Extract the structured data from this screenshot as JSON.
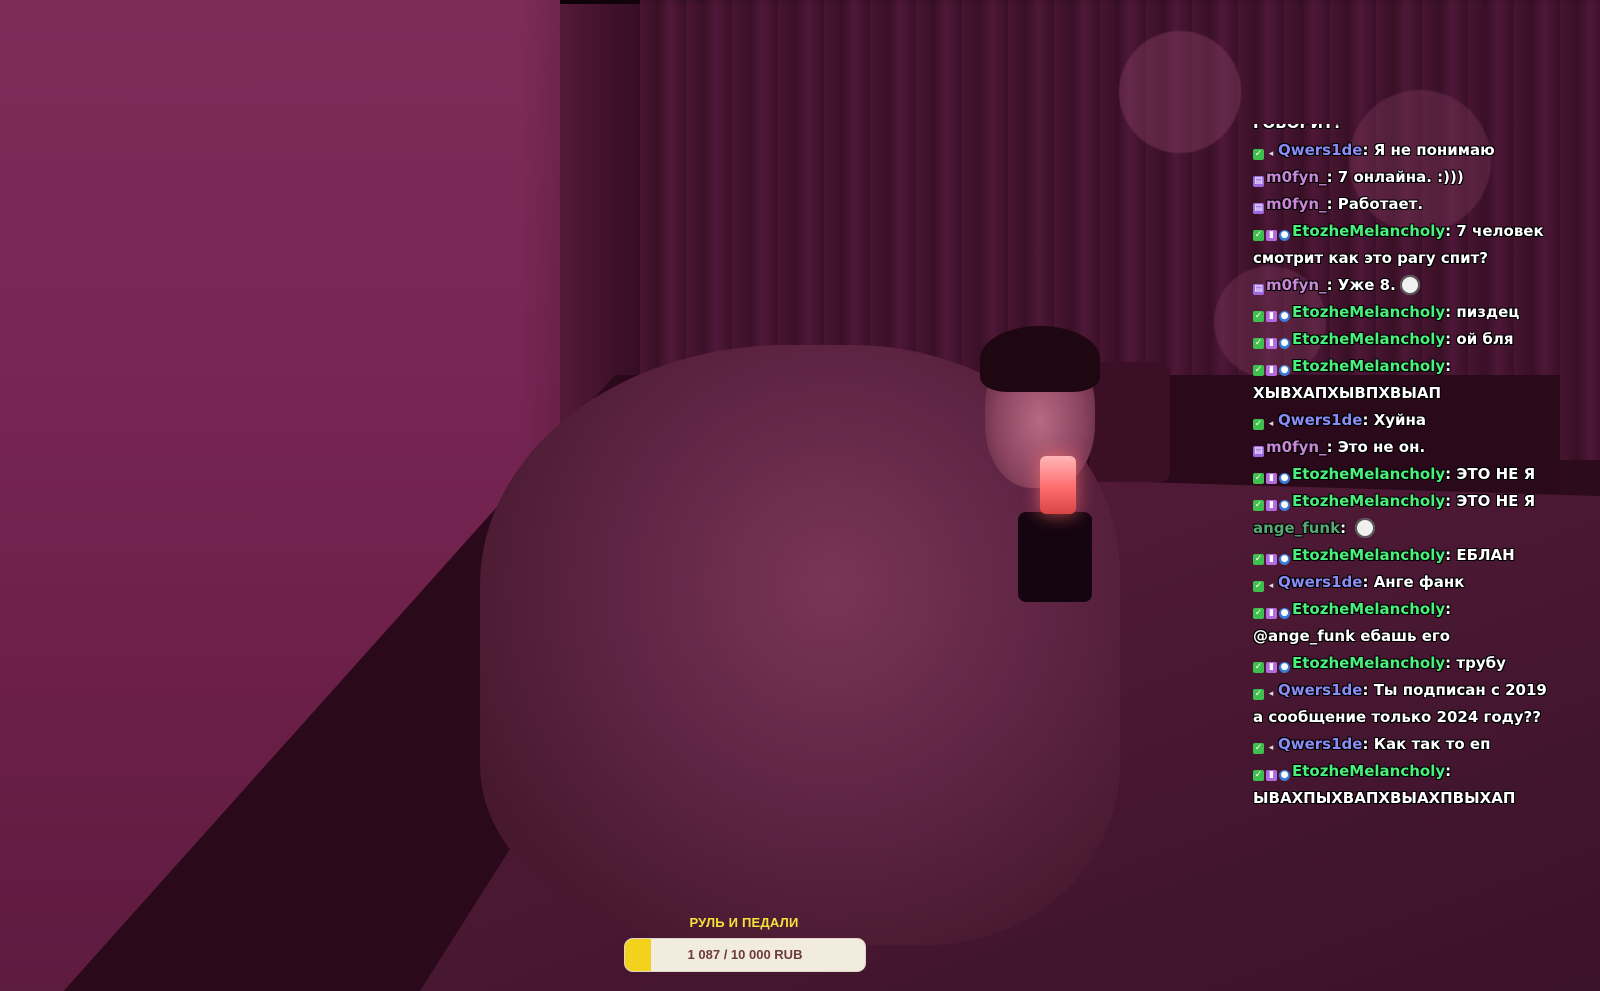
{
  "chat": {
    "messages": [
      {
        "user": "",
        "name_color": "green",
        "badges": [],
        "text": "ГОВОРИТ?",
        "partial": true
      },
      {
        "user": "Qwers1de",
        "name_color": "blue",
        "badges": [
          "check-icon",
          "sound-icon"
        ],
        "text": "Я не понимаю"
      },
      {
        "user": "m0fyn_",
        "name_color": "purple",
        "badges": [
          "mod-icon"
        ],
        "text": "7 онлайна. :)))"
      },
      {
        "user": "m0fyn_",
        "name_color": "purple",
        "badges": [
          "mod-icon"
        ],
        "text": "Работает."
      },
      {
        "user": "EtozheMelancholy",
        "name_color": "green",
        "badges": [
          "check-icon",
          "sub-icon",
          "vip-icon"
        ],
        "text": "7 человек смотрит как это рагу спит?"
      },
      {
        "user": "m0fyn_",
        "name_color": "purple",
        "badges": [
          "mod-icon"
        ],
        "text": "Уже 8.",
        "emote": "skull-emote"
      },
      {
        "user": "EtozheMelancholy",
        "name_color": "green",
        "badges": [
          "check-icon",
          "sub-icon",
          "vip-icon"
        ],
        "text": "пиздец"
      },
      {
        "user": "EtozheMelancholy",
        "name_color": "green",
        "badges": [
          "check-icon",
          "sub-icon",
          "vip-icon"
        ],
        "text": "ой бля"
      },
      {
        "user": "EtozheMelancholy",
        "name_color": "green",
        "badges": [
          "check-icon",
          "sub-icon",
          "vip-icon"
        ],
        "text": "ХЫВХАПХЫВПХВЫАП"
      },
      {
        "user": "Qwers1de",
        "name_color": "blue",
        "badges": [
          "check-icon",
          "sound-icon"
        ],
        "text": "Хуйна"
      },
      {
        "user": "m0fyn_",
        "name_color": "purple",
        "badges": [
          "mod-icon"
        ],
        "text": "Это не он."
      },
      {
        "user": "EtozheMelancholy",
        "name_color": "green",
        "badges": [
          "check-icon",
          "sub-icon",
          "vip-icon"
        ],
        "text": "ЭТО НЕ Я"
      },
      {
        "user": "EtozheMelancholy",
        "name_color": "green",
        "badges": [
          "check-icon",
          "sub-icon",
          "vip-icon"
        ],
        "text": "ЭТО НЕ Я"
      },
      {
        "user": "ange_funk",
        "name_color": "teal",
        "badges": [],
        "text": "",
        "emote": "mask-emote"
      },
      {
        "user": "EtozheMelancholy",
        "name_color": "green",
        "badges": [
          "check-icon",
          "sub-icon",
          "vip-icon"
        ],
        "text": "ЕБЛАН"
      },
      {
        "user": "Qwers1de",
        "name_color": "blue",
        "badges": [
          "check-icon",
          "sound-icon"
        ],
        "text": "Анге фанк"
      },
      {
        "user": "EtozheMelancholy",
        "name_color": "green",
        "badges": [
          "check-icon",
          "sub-icon",
          "vip-icon"
        ],
        "text": "@ange_funk ебашь его"
      },
      {
        "user": "EtozheMelancholy",
        "name_color": "green",
        "badges": [
          "check-icon",
          "sub-icon",
          "vip-icon"
        ],
        "text": "трубу"
      },
      {
        "user": "Qwers1de",
        "name_color": "blue",
        "badges": [
          "check-icon",
          "sound-icon"
        ],
        "text": "Ты подписан с 2019 а сообщение только 2024 году??"
      },
      {
        "user": "Qwers1de",
        "name_color": "blue",
        "badges": [
          "check-icon",
          "sound-icon"
        ],
        "text": "Как так то еп"
      },
      {
        "user": "EtozheMelancholy",
        "name_color": "green",
        "badges": [
          "check-icon",
          "sub-icon",
          "vip-icon"
        ],
        "text": "ЫВАХПЫХВАПХВЫАХПВЫХАП"
      }
    ]
  },
  "goal": {
    "title": "РУЛЬ И ПЕДАЛИ",
    "progress_text": "1 087 / 10 000 RUB",
    "current": 1087,
    "target": 10000,
    "fill_color": "#f2d21c",
    "title_color": "#f6e23a"
  }
}
